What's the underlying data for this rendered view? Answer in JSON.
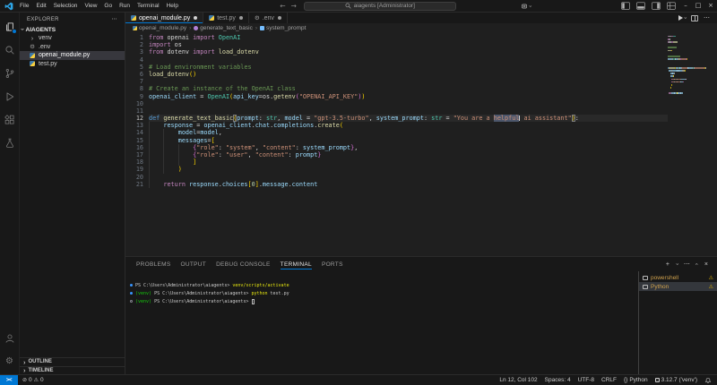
{
  "colors": {
    "kw": "#C586C0",
    "def": "#569CD6",
    "fn": "#DCDCAA",
    "cls": "#4EC9B0",
    "var": "#9CDCFE",
    "str": "#CE9178",
    "com": "#6A9955",
    "pl": "#D4D4D4",
    "num": "#B5CEA8",
    "b1": "#FFD700",
    "b2": "#DA70D6",
    "b3": "#179FFF",
    "bm": "#FFD700",
    "hl": "#CE9178",
    "caret": "#FFFFFF",
    "accent": "#0078D4",
    "warning": "#DDB100",
    "terminal_command": "#E5E510",
    "venv_green": "#16C60C"
  },
  "icons": {
    "more": "⋯",
    "minimize": "–",
    "maximize": "□",
    "close": "×",
    "plus": "+",
    "chevron": "›",
    "back": "←",
    "forward": "→",
    "error": "⊘",
    "warning": "⚠",
    "gear": "⚙",
    "braces": "{}",
    "remote": "><"
  },
  "titlebar": {
    "menus": [
      "File",
      "Edit",
      "Selection",
      "View",
      "Go",
      "Run",
      "Terminal",
      "Help"
    ],
    "search_label": "aiagents [Administrator]"
  },
  "sidebar": {
    "title": "EXPLORER",
    "project": "AIAGENTS",
    "files": [
      {
        "label": "venv",
        "icon": "folder-chevron",
        "selected": false
      },
      {
        "label": ".env",
        "icon": "gear",
        "selected": false
      },
      {
        "label": "openai_module.py",
        "icon": "python",
        "selected": true
      },
      {
        "label": "test.py",
        "icon": "python",
        "selected": false
      }
    ],
    "bottom_sections": [
      "OUTLINE",
      "TIMELINE"
    ]
  },
  "tabs": [
    {
      "label": "openai_module.py",
      "icon": "python",
      "active": true,
      "modified": true
    },
    {
      "label": "test.py",
      "icon": "python",
      "active": false,
      "modified": true
    },
    {
      "label": ".env",
      "icon": "gear",
      "active": false,
      "modified": true
    }
  ],
  "breadcrumb": [
    {
      "label": "openai_module.py",
      "icon": "python"
    },
    {
      "label": "generate_text_basic",
      "icon": "method"
    },
    {
      "label": "system_prompt",
      "icon": "variable"
    }
  ],
  "editor": {
    "current_line": 12,
    "lines": [
      {
        "n": 1,
        "t": [
          [
            "kw",
            "from"
          ],
          [
            "pl",
            " openai "
          ],
          [
            "kw",
            "import"
          ],
          [
            "cls",
            " OpenAI"
          ]
        ]
      },
      {
        "n": 2,
        "t": [
          [
            "kw",
            "import"
          ],
          [
            "pl",
            " os"
          ]
        ]
      },
      {
        "n": 3,
        "t": [
          [
            "kw",
            "from"
          ],
          [
            "pl",
            " dotenv "
          ],
          [
            "kw",
            "import"
          ],
          [
            "fn",
            " load_dotenv"
          ]
        ]
      },
      {
        "n": 4,
        "t": []
      },
      {
        "n": 5,
        "t": [
          [
            "com",
            "# Load environment variables"
          ]
        ]
      },
      {
        "n": 6,
        "t": [
          [
            "fn",
            "load_dotenv"
          ],
          [
            "b1",
            "()"
          ]
        ]
      },
      {
        "n": 7,
        "t": []
      },
      {
        "n": 8,
        "t": [
          [
            "com",
            "# Create an instance of the OpenAI class"
          ]
        ]
      },
      {
        "n": 9,
        "t": [
          [
            "var",
            "openai_client"
          ],
          [
            "pl",
            " = "
          ],
          [
            "cls",
            "OpenAI"
          ],
          [
            "b1",
            "("
          ],
          [
            "var",
            "api_key"
          ],
          [
            "pl",
            "=os."
          ],
          [
            "fn",
            "getenv"
          ],
          [
            "b2",
            "("
          ],
          [
            "str",
            "\"OPENAI_API_KEY\""
          ],
          [
            "b2",
            ")"
          ],
          [
            "b1",
            ")"
          ]
        ]
      },
      {
        "n": 10,
        "t": []
      },
      {
        "n": 11,
        "t": []
      },
      {
        "n": 12,
        "t": [
          [
            "def",
            "def"
          ],
          [
            "fn",
            " generate_text_basic"
          ],
          [
            "bm",
            "("
          ],
          [
            "var",
            "prompt"
          ],
          [
            "pl",
            ": "
          ],
          [
            "cls",
            "str"
          ],
          [
            "pl",
            ", "
          ],
          [
            "var",
            "model"
          ],
          [
            "pl",
            " = "
          ],
          [
            "str",
            "\"gpt-3.5-turbo\""
          ],
          [
            "pl",
            ", "
          ],
          [
            "var",
            "system_prompt"
          ],
          [
            "pl",
            ": "
          ],
          [
            "cls",
            "str"
          ],
          [
            "pl",
            " = "
          ],
          [
            "str",
            "\"You are a "
          ],
          [
            "hl",
            "helpful"
          ],
          [
            "caret",
            ""
          ],
          [
            "str",
            " ai assistant\""
          ],
          [
            "bm",
            ")"
          ],
          [
            "pl",
            ":"
          ]
        ]
      },
      {
        "n": 13,
        "g": [
          0
        ],
        "t": [
          [
            "pl",
            "    "
          ],
          [
            "var",
            "response"
          ],
          [
            "pl",
            " = "
          ],
          [
            "var",
            "openai_client"
          ],
          [
            "pl",
            "."
          ],
          [
            "var",
            "chat"
          ],
          [
            "pl",
            "."
          ],
          [
            "var",
            "completions"
          ],
          [
            "pl",
            "."
          ],
          [
            "fn",
            "create"
          ],
          [
            "b1",
            "("
          ]
        ]
      },
      {
        "n": 14,
        "g": [
          0,
          4
        ],
        "t": [
          [
            "pl",
            "        "
          ],
          [
            "var",
            "model"
          ],
          [
            "pl",
            "="
          ],
          [
            "var",
            "model"
          ],
          [
            "pl",
            ","
          ]
        ]
      },
      {
        "n": 15,
        "g": [
          0,
          4
        ],
        "t": [
          [
            "pl",
            "        "
          ],
          [
            "var",
            "messages"
          ],
          [
            "pl",
            "="
          ],
          [
            "b1",
            "["
          ]
        ]
      },
      {
        "n": 16,
        "g": [
          0,
          4,
          8
        ],
        "t": [
          [
            "pl",
            "            "
          ],
          [
            "b2",
            "{"
          ],
          [
            "str",
            "\"role\""
          ],
          [
            "pl",
            ": "
          ],
          [
            "str",
            "\"system\""
          ],
          [
            "pl",
            ", "
          ],
          [
            "str",
            "\"content\""
          ],
          [
            "pl",
            ": "
          ],
          [
            "var",
            "system_prompt"
          ],
          [
            "b2",
            "}"
          ],
          [
            "pl",
            ","
          ]
        ]
      },
      {
        "n": 17,
        "g": [
          0,
          4,
          8
        ],
        "t": [
          [
            "pl",
            "            "
          ],
          [
            "b2",
            "{"
          ],
          [
            "str",
            "\"role\""
          ],
          [
            "pl",
            ": "
          ],
          [
            "str",
            "\"user\""
          ],
          [
            "pl",
            ", "
          ],
          [
            "str",
            "\"content\""
          ],
          [
            "pl",
            ": "
          ],
          [
            "var",
            "prompt"
          ],
          [
            "b2",
            "}"
          ]
        ]
      },
      {
        "n": 18,
        "g": [
          0,
          4,
          8
        ],
        "t": [
          [
            "pl",
            "            "
          ],
          [
            "b1",
            "]"
          ]
        ]
      },
      {
        "n": 19,
        "g": [
          0,
          4
        ],
        "t": [
          [
            "pl",
            "        "
          ],
          [
            "b1",
            ")"
          ]
        ]
      },
      {
        "n": 20,
        "g": [
          0
        ],
        "t": []
      },
      {
        "n": 21,
        "g": [
          0
        ],
        "t": [
          [
            "pl",
            "    "
          ],
          [
            "kw",
            "return"
          ],
          [
            "pl",
            " "
          ],
          [
            "var",
            "response"
          ],
          [
            "pl",
            "."
          ],
          [
            "var",
            "choices"
          ],
          [
            "b1",
            "["
          ],
          [
            "num",
            "0"
          ],
          [
            "b1",
            "]"
          ],
          [
            "pl",
            "."
          ],
          [
            "var",
            "message"
          ],
          [
            "pl",
            "."
          ],
          [
            "var",
            "content"
          ]
        ]
      }
    ]
  },
  "panel": {
    "tabs": [
      {
        "label": "PROBLEMS",
        "active": false
      },
      {
        "label": "OUTPUT",
        "active": false
      },
      {
        "label": "DEBUG CONSOLE",
        "active": false
      },
      {
        "label": "TERMINAL",
        "active": true
      },
      {
        "label": "PORTS",
        "active": false
      }
    ],
    "terminal": {
      "lines": [
        {
          "decoration": "done",
          "segments": [
            [
              "pl",
              "PS C:\\Users\\Administrator\\aiagents> "
            ],
            [
              "cmd",
              "venv/scripts/activate"
            ]
          ]
        },
        {
          "decoration": "done",
          "segments": [
            [
              "venv",
              "(venv) "
            ],
            [
              "pl",
              "PS C:\\Users\\Administrator\\aiagents> "
            ],
            [
              "cmd",
              "python"
            ],
            [
              "pl",
              " test.py"
            ]
          ]
        },
        {
          "decoration": "pending",
          "segments": [
            [
              "venv",
              "(venv) "
            ],
            [
              "pl",
              "PS C:\\Users\\Administrator\\aiagents> "
            ],
            [
              "cursor",
              ""
            ]
          ]
        }
      ]
    },
    "terminal_list": [
      {
        "label": "powershell",
        "selected": false,
        "warning": true
      },
      {
        "label": "Python",
        "selected": true,
        "warning": true
      }
    ]
  },
  "statusbar": {
    "errors": "0",
    "warnings": "0",
    "cursor": "Ln 12, Col 102",
    "indent": "Spaces: 4",
    "encoding": "UTF-8",
    "eol": "CRLF",
    "language": "Python",
    "interpreter": "3.12.7 ('venv')"
  }
}
